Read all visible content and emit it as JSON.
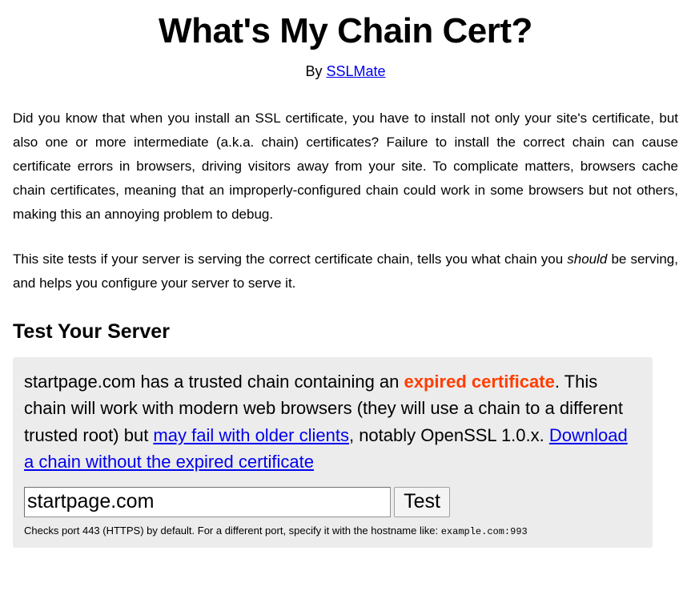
{
  "header": {
    "title": "What's My Chain Cert?",
    "byline_prefix": "By ",
    "byline_link": "SSLMate"
  },
  "intro": {
    "paragraph1": "Did you know that when you install an SSL certificate, you have to install not only your site's certificate, but also one or more intermediate (a.k.a. chain) certificates? Failure to install the correct chain can cause certificate errors in browsers, driving visitors away from your site. To complicate matters, browsers cache chain certificates, meaning that an improperly-configured chain could work in some browsers but not others, making this an annoying problem to debug.",
    "paragraph2_part1": "This site tests if your server is serving the correct certificate chain, tells you what chain you ",
    "paragraph2_emphasis": "should",
    "paragraph2_part2": " be serving, and helps you configure your server to serve it."
  },
  "test_section": {
    "heading": "Test Your Server",
    "result": {
      "text_part1": "startpage.com has a trusted chain containing an ",
      "alert_text": "expired certificate",
      "text_part2": ". This chain will work with modern web browsers (they will use a chain to a different trusted root) but ",
      "link1": "may fail with older clients",
      "text_part3": ", notably OpenSSL 1.0.x. ",
      "link2": "Download a chain without the expired certificate",
      "alert_color": "#ff3d00"
    },
    "form": {
      "hostname_value": "startpage.com",
      "hostname_placeholder": "example.com",
      "submit_label": "Test"
    },
    "hint_text": "Checks port 443 (HTTPS) by default. For a different port, specify it with the hostname like: ",
    "hint_example": "example.com:993"
  }
}
